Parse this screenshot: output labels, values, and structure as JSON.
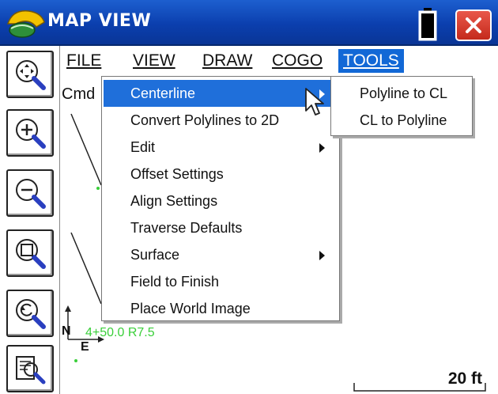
{
  "window": {
    "title": "MAP VIEW"
  },
  "menubar": {
    "items": [
      {
        "label": "FILE"
      },
      {
        "label": "VIEW"
      },
      {
        "label": "DRAW"
      },
      {
        "label": "COGO"
      },
      {
        "label": "TOOLS",
        "active": true
      }
    ]
  },
  "toolbar": {
    "buttons": [
      {
        "icon": "zoom-extents-icon"
      },
      {
        "icon": "zoom-in-icon"
      },
      {
        "icon": "zoom-out-icon"
      },
      {
        "icon": "zoom-window-icon"
      },
      {
        "icon": "zoom-previous-icon"
      },
      {
        "icon": "zoom-list-icon"
      }
    ]
  },
  "map": {
    "command_label": "Cmd",
    "station_label": "4+50.0 R7.5",
    "north_label": "N",
    "east_label": "E"
  },
  "tools_menu": {
    "items": [
      {
        "label": "Centerline",
        "submenu": true,
        "highlighted": true
      },
      {
        "label": "Convert Polylines to 2D",
        "submenu": false
      },
      {
        "label": "Edit",
        "submenu": true
      },
      {
        "label": "Offset Settings",
        "submenu": false
      },
      {
        "label": "Align Settings",
        "submenu": false
      },
      {
        "label": "Traverse Defaults",
        "submenu": false
      },
      {
        "label": "Surface",
        "submenu": true
      },
      {
        "label": "Field to Finish",
        "submenu": false
      },
      {
        "label": "Place World Image",
        "submenu": false
      }
    ]
  },
  "centerline_submenu": {
    "items": [
      {
        "label": "Polyline to CL"
      },
      {
        "label": "CL to Polyline"
      }
    ]
  },
  "statusbar": {
    "scale": "20 ft"
  },
  "colors": {
    "titlebar": "#0b3fae",
    "highlight": "#1f6fda",
    "close_button": "#d8392b",
    "map_green": "#3acf3a"
  }
}
